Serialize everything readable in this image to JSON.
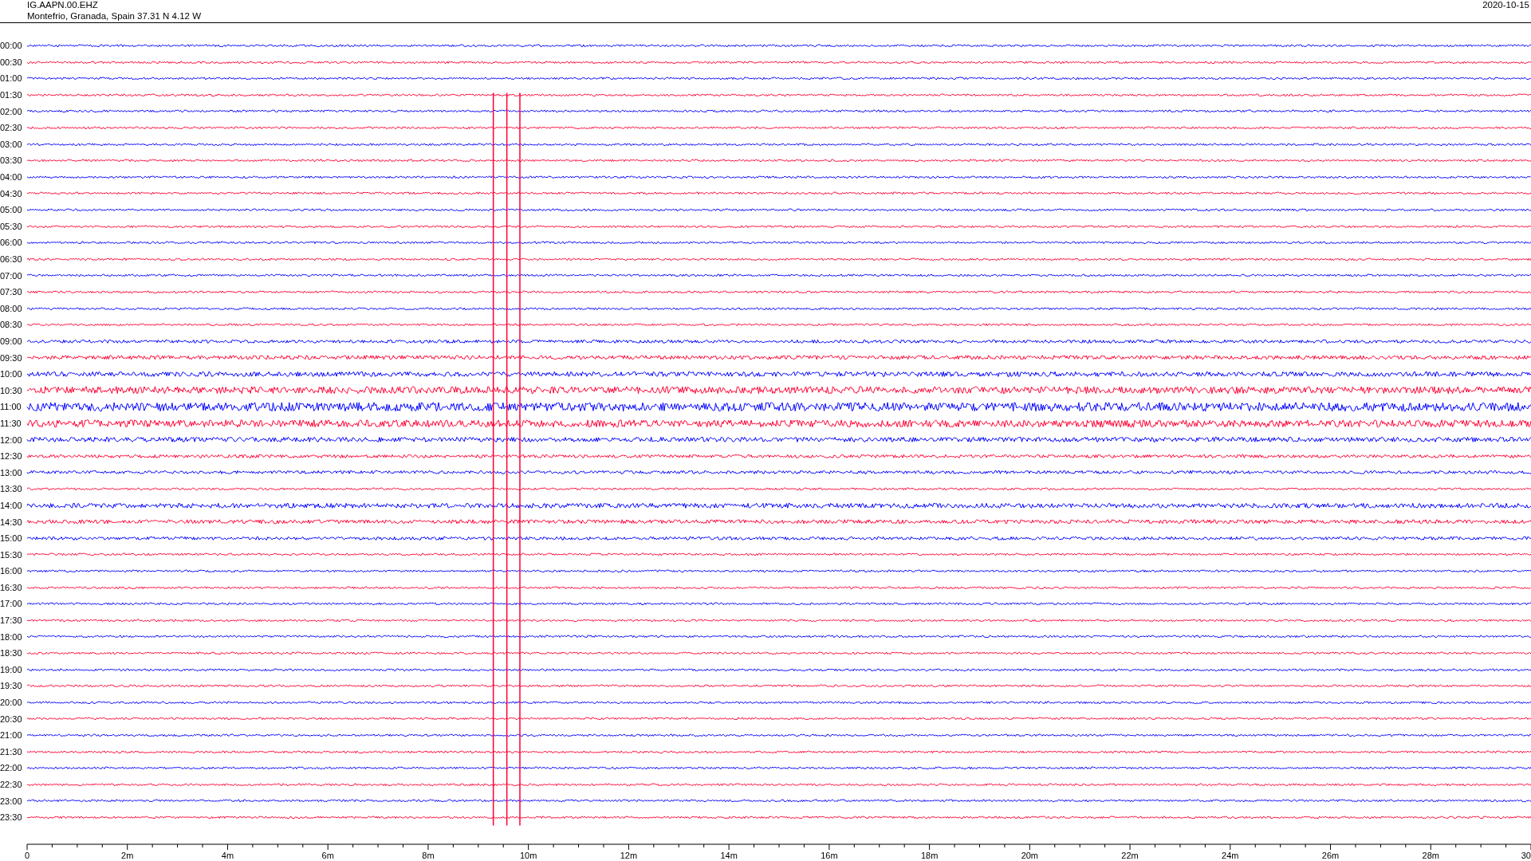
{
  "header": {
    "station": "IG.AAPN.00.EHZ",
    "location": "Montefrio, Granada, Spain  37.31 N 4.12 W",
    "date": "2020-10-15"
  },
  "rows": [
    {
      "label": "00:00",
      "color": "#0000ff"
    },
    {
      "label": "00:30",
      "color": "#ff0033"
    },
    {
      "label": "01:00",
      "color": "#0000ff"
    },
    {
      "label": "01:30",
      "color": "#ff0033"
    },
    {
      "label": "02:00",
      "color": "#0000ff"
    },
    {
      "label": "02:30",
      "color": "#ff0033"
    },
    {
      "label": "03:00",
      "color": "#0000ff"
    },
    {
      "label": "03:30",
      "color": "#ff0033"
    },
    {
      "label": "04:00",
      "color": "#0000ff"
    },
    {
      "label": "04:30",
      "color": "#ff0033"
    },
    {
      "label": "05:00",
      "color": "#0000ff"
    },
    {
      "label": "05:30",
      "color": "#ff0033"
    },
    {
      "label": "06:00",
      "color": "#0000ff"
    },
    {
      "label": "06:30",
      "color": "#ff0033"
    },
    {
      "label": "07:00",
      "color": "#0000ff"
    },
    {
      "label": "07:30",
      "color": "#ff0033"
    },
    {
      "label": "08:00",
      "color": "#0000ff"
    },
    {
      "label": "08:30",
      "color": "#ff0033"
    },
    {
      "label": "09:00",
      "color": "#0000ff"
    },
    {
      "label": "09:30",
      "color": "#ff0033"
    },
    {
      "label": "10:00",
      "color": "#0000ff"
    },
    {
      "label": "10:30",
      "color": "#ff0033"
    },
    {
      "label": "11:00",
      "color": "#0000ff"
    },
    {
      "label": "11:30",
      "color": "#ff0033"
    },
    {
      "label": "12:00",
      "color": "#0000ff"
    },
    {
      "label": "12:30",
      "color": "#ff0033"
    },
    {
      "label": "13:00",
      "color": "#0000ff"
    },
    {
      "label": "13:30",
      "color": "#ff0033"
    },
    {
      "label": "14:00",
      "color": "#0000ff"
    },
    {
      "label": "14:30",
      "color": "#ff0033"
    },
    {
      "label": "15:00",
      "color": "#0000ff"
    },
    {
      "label": "15:30",
      "color": "#ff0033"
    },
    {
      "label": "16:00",
      "color": "#0000ff"
    },
    {
      "label": "16:30",
      "color": "#ff0033"
    },
    {
      "label": "17:00",
      "color": "#0000ff"
    },
    {
      "label": "17:30",
      "color": "#ff0033"
    },
    {
      "label": "18:00",
      "color": "#0000ff"
    },
    {
      "label": "18:30",
      "color": "#ff0033"
    },
    {
      "label": "19:00",
      "color": "#0000ff"
    },
    {
      "label": "19:30",
      "color": "#ff0033"
    },
    {
      "label": "20:00",
      "color": "#0000ff"
    },
    {
      "label": "20:30",
      "color": "#ff0033"
    },
    {
      "label": "21:00",
      "color": "#0000ff"
    },
    {
      "label": "21:30",
      "color": "#ff0033"
    },
    {
      "label": "22:00",
      "color": "#0000ff"
    },
    {
      "label": "22:30",
      "color": "#ff0033"
    },
    {
      "label": "23:00",
      "color": "#0000ff"
    },
    {
      "label": "23:30",
      "color": "#ff0033"
    }
  ],
  "time_axis": {
    "ticks": [
      "0",
      "2m",
      "4m",
      "6m",
      "8m",
      "10m",
      "12m",
      "14m",
      "16m",
      "18m",
      "20m",
      "22m",
      "24m",
      "26m",
      "28m",
      "30"
    ]
  }
}
